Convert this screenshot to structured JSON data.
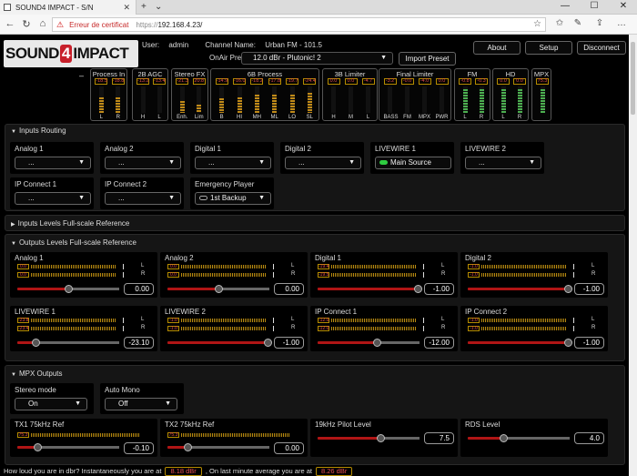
{
  "browser": {
    "tab_title": "SOUND4 IMPACT - S/N",
    "cert_error": "Erreur de certificat",
    "url_scheme": "https://",
    "url_host": "192.168.4.23/"
  },
  "header": {
    "logo_left": "SOUND",
    "logo_num": "4",
    "logo_right": "IMPACT",
    "user_label": "User:",
    "user": "admin",
    "channel_label": "Channel Name:",
    "channel": "Urban FM - 101.5",
    "onair_label": "OnAir Preset:",
    "preset": "12.0 dBr - Plutonic! 2",
    "import": "Import Preset",
    "about": "About",
    "setup": "Setup",
    "disconnect": "Disconnect"
  },
  "meters": {
    "dash": "–",
    "groups": [
      {
        "title": "Process In",
        "vals": [
          "-18.5",
          "-18.8"
        ],
        "labels": [
          "L",
          "R"
        ],
        "levels": [
          0.6,
          0.6
        ]
      },
      {
        "title": "2B AGC",
        "vals": [
          "-13.2",
          "-13.4"
        ],
        "labels": [
          "H",
          "L"
        ],
        "levels": [
          0.0,
          0.0
        ]
      },
      {
        "title": "Stereo FX",
        "vals": [
          "-21.3",
          "20.8"
        ],
        "labels": [
          "Enh.",
          "Lim"
        ],
        "levels": [
          0.45,
          0.3
        ]
      },
      {
        "title": "6B Process",
        "vals": [
          "-14.9",
          "-16.0",
          "-18.2",
          "-17.8",
          "-19.7",
          "-24.4"
        ],
        "labels": [
          "B",
          "HI",
          "MH",
          "ML",
          "LO",
          "SL"
        ],
        "levels": [
          0.55,
          0.6,
          0.7,
          0.7,
          0.7,
          0.75
        ]
      },
      {
        "title": "3B Limiter",
        "vals": [
          "0.0",
          "0.0",
          "-4.7"
        ],
        "labels": [
          "H",
          "M",
          "L"
        ],
        "levels": [
          0.0,
          0.0,
          0.0
        ]
      },
      {
        "title": "Final Limiter",
        "vals": [
          "-3.2",
          "-0.0",
          "-4.0",
          "0.0"
        ],
        "labels": [
          "BASS",
          "FM",
          "MPX",
          "PWR"
        ],
        "levels": [
          0.0,
          0.0,
          0.0,
          0.0
        ]
      },
      {
        "title": "FM",
        "vals": [
          "-0.8",
          "-0.3"
        ],
        "labels": [
          "L",
          "R"
        ],
        "levels": [
          0.9,
          0.9
        ]
      },
      {
        "title": "HD",
        "vals": [
          "0.0",
          "0.0"
        ],
        "labels": [
          "L",
          "R"
        ],
        "levels": [
          0.9,
          0.9
        ]
      },
      {
        "title": "MPX",
        "vals": [
          "75.3"
        ],
        "labels": [],
        "levels": [
          0.9
        ]
      }
    ]
  },
  "inputs_routing": {
    "title": "Inputs Routing",
    "cards": [
      {
        "label": "Analog 1",
        "value": "..."
      },
      {
        "label": "Analog 2",
        "value": "..."
      },
      {
        "label": "Digital 1",
        "value": "..."
      },
      {
        "label": "Digital 2",
        "value": "..."
      },
      {
        "label": "LIVEWIRE 1",
        "value": "Main Source",
        "lamp": "on"
      },
      {
        "label": "LIVEWIRE 2",
        "value": "..."
      },
      {
        "label": "IP Connect 1",
        "value": "..."
      },
      {
        "label": "IP Connect 2",
        "value": "..."
      },
      {
        "label": "Emergency Player",
        "value": "1st Backup",
        "lamp": "off"
      }
    ]
  },
  "inputs_levels": {
    "title": "Inputs Levels Full-scale Reference"
  },
  "outputs_levels": {
    "title": "Outputs Levels Full-scale Reference",
    "cards": [
      {
        "label": "Analog 1",
        "l": "0.0",
        "r": "0.0",
        "value": "0.00",
        "slider": 0.5
      },
      {
        "label": "Analog 2",
        "l": "0.0",
        "r": "0.0",
        "value": "0.00",
        "slider": 0.5
      },
      {
        "label": "Digital 1",
        "l": "-19.4",
        "r": "-19.5",
        "value": "-1.00",
        "slider": 0.98
      },
      {
        "label": "Digital 2",
        "l": "-1.0",
        "r": "-1.0",
        "value": "-1.00",
        "slider": 0.98
      },
      {
        "label": "LIVEWIRE 1",
        "l": "-23.8",
        "r": "-23.4",
        "value": "-23.10",
        "slider": 0.18
      },
      {
        "label": "LIVEWIRE 2",
        "l": "-1.0",
        "r": "-1.0",
        "value": "-1.00",
        "slider": 0.98
      },
      {
        "label": "IP Connect 1",
        "l": "-12.0",
        "r": "-12.0",
        "value": "-12.00",
        "slider": 0.58
      },
      {
        "label": "IP Connect 2",
        "l": "-1.0",
        "r": "-1.0",
        "value": "-1.00",
        "slider": 0.98
      }
    ]
  },
  "mpx_outputs": {
    "title": "MPX Outputs",
    "stereo_label": "Stereo mode",
    "stereo": "On",
    "automono_label": "Auto Mono",
    "automono": "Off",
    "cards": [
      {
        "label": "TX1 75kHz Ref",
        "meter": "75.3",
        "value": "-0.10",
        "slider": 0.2
      },
      {
        "label": "TX2 75kHz Ref",
        "meter": "75.3",
        "value": "0.00",
        "slider": 0.2
      },
      {
        "label": "19kHz Pilot Level",
        "value": "7.5",
        "slider": 0.62
      },
      {
        "label": "RDS Level",
        "value": "4.0",
        "slider": 0.35
      }
    ]
  },
  "footer": {
    "q": "How loud you are in dbr? Instantaneously you are at",
    "inst": "8.18 dBr",
    "mid": ", On last minute average you are at",
    "avg": "8.26 dBr"
  }
}
